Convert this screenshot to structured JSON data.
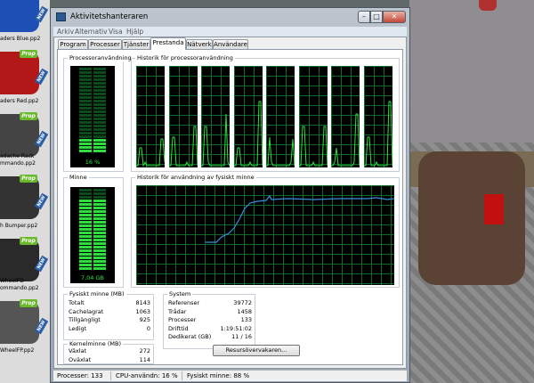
{
  "window": {
    "title": "Aktivitetshanteraren",
    "minimize_glyph": "–",
    "maximize_glyph": "□",
    "close_glyph": "✕"
  },
  "menu": [
    "Arkiv",
    "Alternativ",
    "Visa",
    "Hjälp"
  ],
  "tabs": [
    "Program",
    "Processer",
    "Tjänster",
    "Prestanda",
    "Nätverk",
    "Användare"
  ],
  "active_tab": "Prestanda",
  "cpu": {
    "usage_title": "Processoranvändning",
    "usage_value": "16 %",
    "usage_percent": 16,
    "history_title": "Historik för processoranvändning",
    "core_count": 8
  },
  "memory": {
    "title": "Minne",
    "value": "7,04 GB",
    "usage_percent": 88,
    "history_title": "Historik för användning av fysiskt minne"
  },
  "physical_memory": {
    "title": "Fysiskt minne (MB)",
    "rows": [
      {
        "label": "Totalt",
        "value": "8143"
      },
      {
        "label": "Cachelagrat",
        "value": "1063"
      },
      {
        "label": "Tillgängligt",
        "value": "925"
      },
      {
        "label": "Ledigt",
        "value": "0"
      }
    ]
  },
  "kernel_memory": {
    "title": "Kernelminne (MB)",
    "rows": [
      {
        "label": "Växlat",
        "value": "272"
      },
      {
        "label": "Oväxlat",
        "value": "114"
      }
    ]
  },
  "system": {
    "title": "System",
    "rows": [
      {
        "label": "Referenser",
        "value": "39772"
      },
      {
        "label": "Trådar",
        "value": "1458"
      },
      {
        "label": "Processer",
        "value": "133"
      },
      {
        "label": "Drifttid",
        "value": "1:19:51:02"
      },
      {
        "label": "Dedikerat (GB)",
        "value": "11 / 16"
      }
    ]
  },
  "resource_monitor_button": "Resursövervakaren...",
  "statusbar": {
    "processes": "Processer: 133",
    "cpu": "CPU-användn: 16 %",
    "memory": "Fysiskt minne: 88 %"
  },
  "background_assets": [
    {
      "badge": "Prop",
      "new": "NEW",
      "line1": "aders Blue.pp2",
      "line2": "",
      "color": "#1e4fb5"
    },
    {
      "badge": "Prop",
      "new": "NEW",
      "line1": "aders Red.pp2",
      "line2": "",
      "color": "#b21818"
    },
    {
      "badge": "Prop",
      "new": "NEW",
      "line1": "adache Rack",
      "line2": "mmando.pp2",
      "color": "#444444"
    },
    {
      "badge": "Prop",
      "new": "NEW",
      "line1": "h Bumper.pp2",
      "line2": "",
      "color": "#333333"
    },
    {
      "badge": "Prop",
      "new": "NEW",
      "line1": "WheelFD",
      "line2": "ommando.pp2",
      "color": "#2a2a2a"
    },
    {
      "badge": "Prop",
      "new": "NEW",
      "line1": "WheelFP.pp2",
      "line2": "",
      "color": "#555555"
    }
  ],
  "colors": {
    "graph_line": "#2ee03f",
    "memory_line": "#3b8fe0",
    "graph_grid": "#0f6b2c",
    "prop_badge": "#6ab82c"
  }
}
